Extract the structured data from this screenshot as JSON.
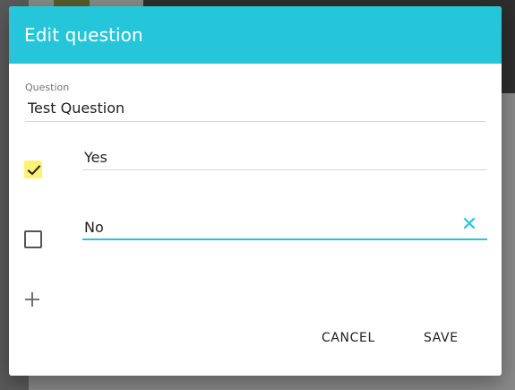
{
  "dialog": {
    "title": "Edit question",
    "header_color": "#26c6da"
  },
  "question": {
    "label": "Question",
    "value": "Test Question"
  },
  "answers": [
    {
      "value": "Yes",
      "checked": true
    },
    {
      "value": "No",
      "checked": false,
      "focused": true
    }
  ],
  "icons": {
    "check": "check-icon",
    "clear": "close-icon",
    "add": "plus-icon"
  },
  "actions": {
    "cancel": "CANCEL",
    "save": "SAVE"
  }
}
